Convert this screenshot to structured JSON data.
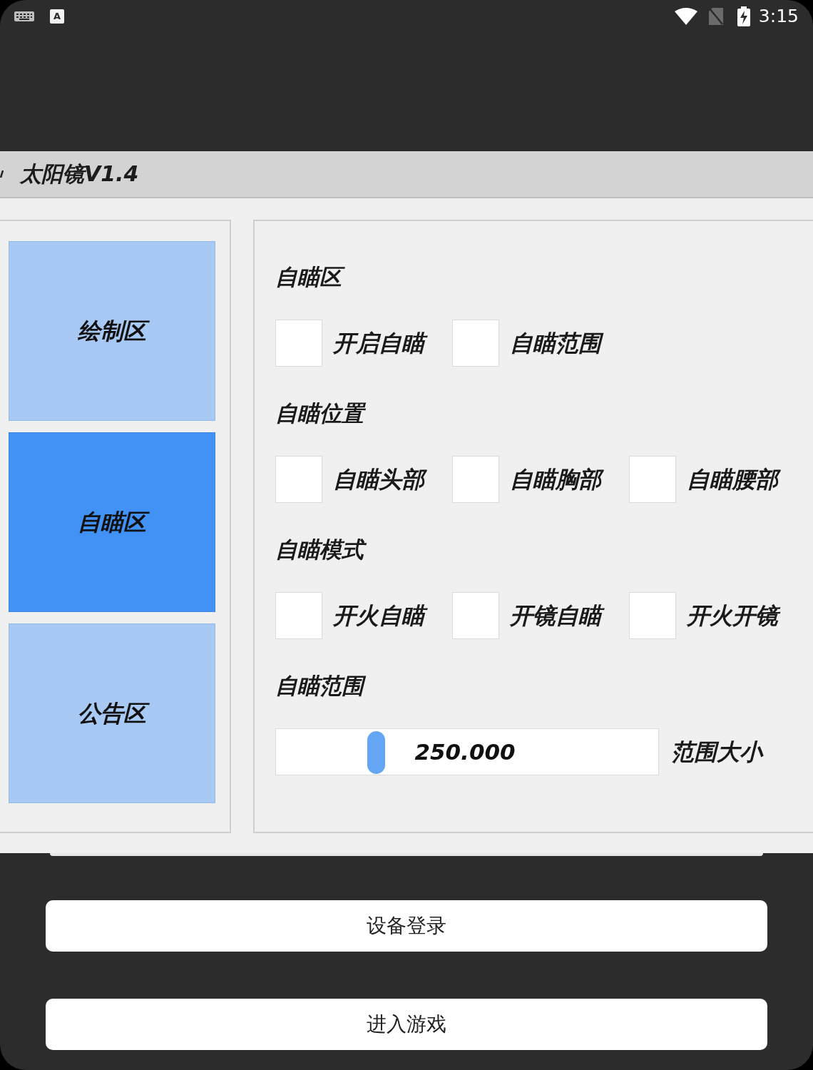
{
  "status_bar": {
    "badge": "A",
    "time": "3:15"
  },
  "window": {
    "title": "太阳镜V1.4"
  },
  "sidebar": {
    "tabs": [
      {
        "label": "绘制区",
        "selected": false
      },
      {
        "label": "自瞄区",
        "selected": true
      },
      {
        "label": "公告区",
        "selected": false
      }
    ]
  },
  "panel": {
    "sections": [
      {
        "title": "自瞄区",
        "kind": "checkboxes",
        "options": [
          {
            "label": "开启自瞄",
            "checked": false
          },
          {
            "label": "自瞄范围",
            "checked": false
          }
        ]
      },
      {
        "title": "自瞄位置",
        "kind": "checkboxes",
        "options": [
          {
            "label": "自瞄头部",
            "checked": false
          },
          {
            "label": "自瞄胸部",
            "checked": false
          },
          {
            "label": "自瞄腰部",
            "checked": false
          }
        ]
      },
      {
        "title": "自瞄模式",
        "kind": "checkboxes",
        "options": [
          {
            "label": "开火自瞄",
            "checked": false
          },
          {
            "label": "开镜自瞄",
            "checked": false
          },
          {
            "label": "开火开镜",
            "checked": false
          }
        ]
      },
      {
        "title": "自瞄范围",
        "kind": "slider",
        "slider": {
          "value": "250.000",
          "level": 0.25,
          "label": "范围大小"
        }
      }
    ]
  },
  "buttons": [
    "设备登录",
    "进入游戏"
  ]
}
